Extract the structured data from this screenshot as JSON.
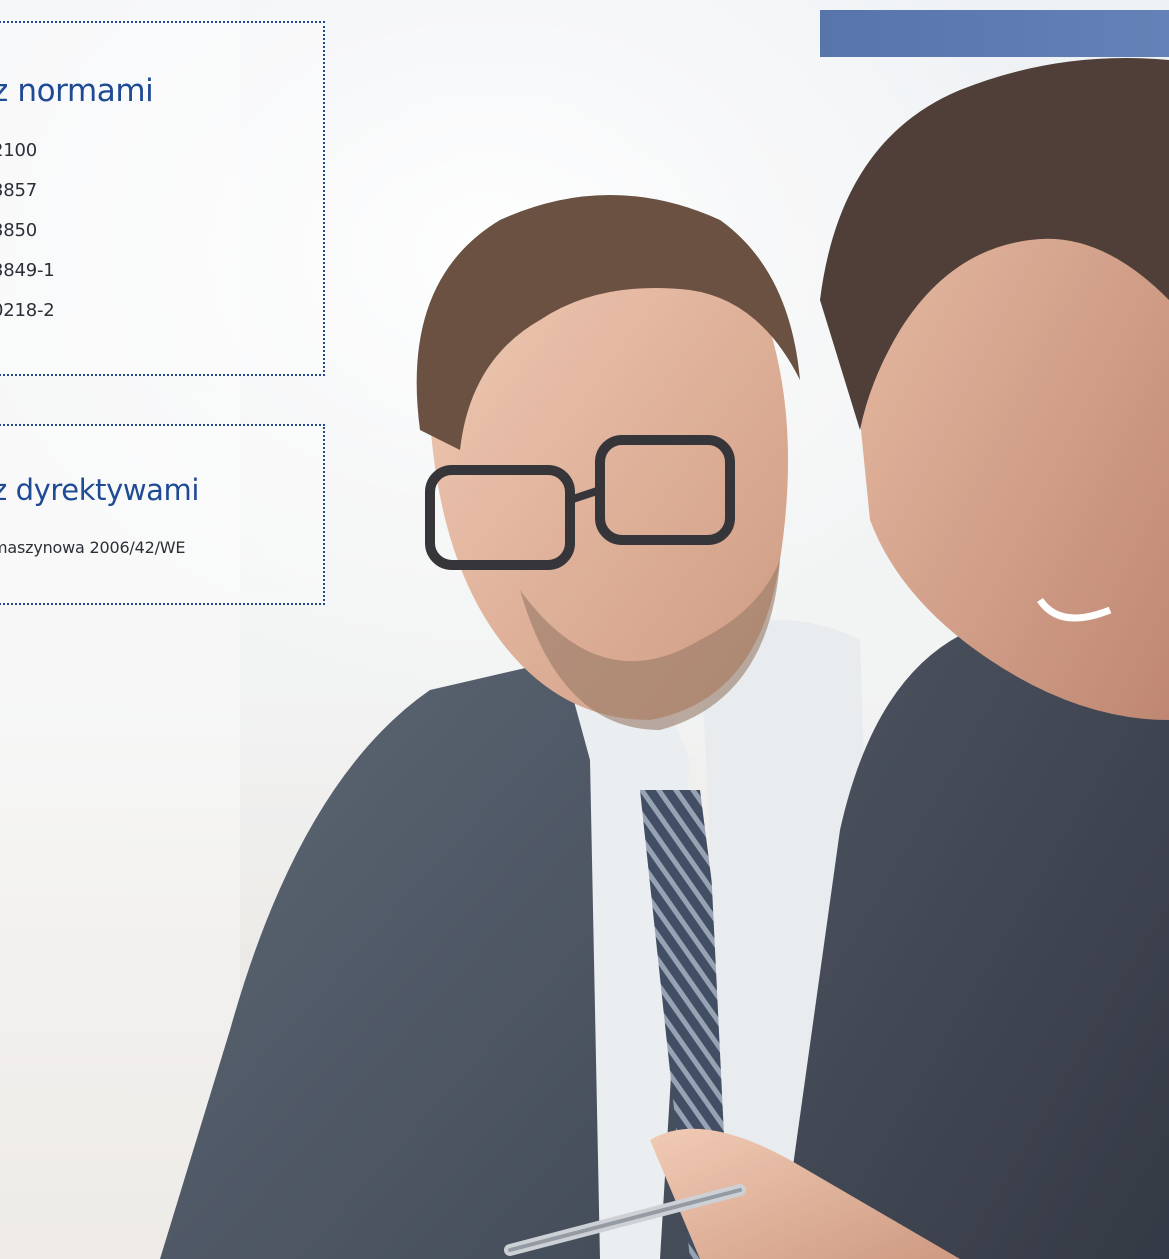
{
  "norms_box": {
    "title": "z normami",
    "items": [
      "2100",
      "3857",
      "3850",
      "3849-1",
      "0218-2"
    ]
  },
  "directives_box": {
    "title": "z dyrektywami",
    "items": [
      "maszynowa 2006/42/WE"
    ]
  },
  "colors": {
    "accent_blue": "#1f4a94",
    "bar_blue": "#5572ab",
    "text_dark": "#2b3038"
  },
  "hero_image": {
    "icon": "business-people-photo"
  }
}
